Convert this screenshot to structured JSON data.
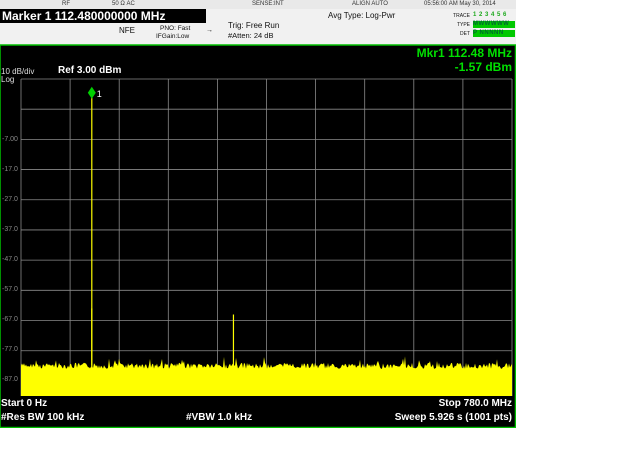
{
  "status_strip": [
    "RF",
    "50 Ω AC",
    "SENSE:INT",
    "ALIGN AUTO",
    "05:56:00 AM May 30, 2014"
  ],
  "header": {
    "marker_title": "Marker 1 112.480000000 MHz",
    "input_mode": "NFE",
    "pno": "PNO: Fast",
    "ifgain": "IFGain:Low",
    "trigger": "Trig: Free Run",
    "atten": "#Atten: 24 dB",
    "avg_type": "Avg Type: Log-Pwr",
    "trace_labels": [
      "TRACE",
      "TYPE",
      "DET"
    ],
    "trace_values": [
      "1 2 3 4 5 6",
      "MWWWWW",
      "P NNNNN"
    ]
  },
  "display": {
    "ref_level": "Ref 3.00 dBm",
    "scale": "10 dB/div",
    "scale_type": "Log",
    "marker_freq": "Mkr1 112.48 MHz",
    "marker_amp": "-1.57 dBm",
    "marker_label": "1",
    "y_ticks": [
      "-7.00",
      "-17.0",
      "-27.0",
      "-37.0",
      "-47.0",
      "-57.0",
      "-67.0",
      "-77.0",
      "-87.0"
    ]
  },
  "footer": {
    "start": "Start 0 Hz",
    "stop": "Stop 780.0 MHz",
    "rbw": "#Res BW 100 kHz",
    "vbw": "#VBW 1.0 kHz",
    "sweep": "Sweep  5.926 s (1001 pts)"
  },
  "chart_data": {
    "type": "line",
    "x_start_mhz": 0,
    "x_stop_mhz": 780,
    "ref_dbm": 3.0,
    "div_db": 10,
    "noise_floor_dbm": -92,
    "peaks": [
      {
        "freq_mhz": 112.48,
        "dbm": -1.57
      },
      {
        "freq_mhz": 112.48,
        "dbm": -73
      },
      {
        "freq_mhz": 337.5,
        "dbm": -75
      }
    ],
    "colors": {
      "trace": "#ffff00",
      "grid": "#8a8a8a",
      "border": "#00c000",
      "marker": "#00d000"
    }
  }
}
